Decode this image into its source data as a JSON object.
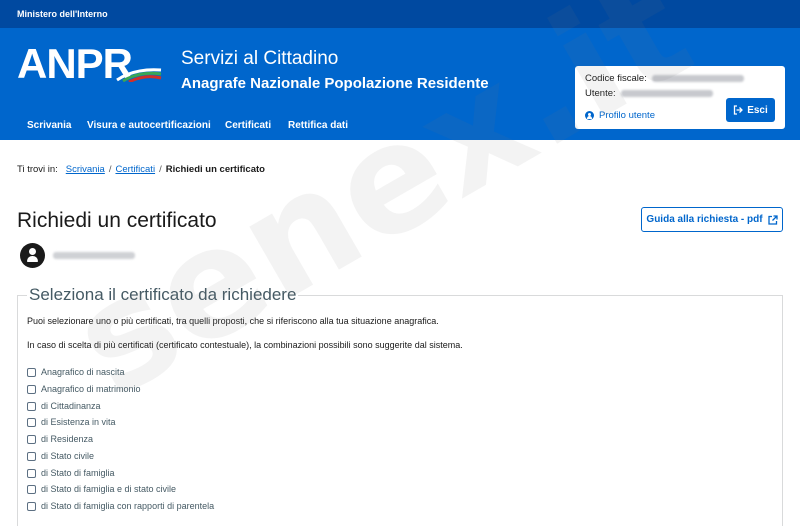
{
  "topbar": {
    "ministry": "Ministero dell'Interno"
  },
  "header": {
    "logo_text": "ANPR",
    "title": "Servizi al Cittadino",
    "subtitle": "Anagrafe Nazionale Popolazione Residente"
  },
  "user": {
    "codice_fiscale_label": "Codice fiscale:",
    "utente_label": "Utente:",
    "profile_link": "Profilo utente",
    "logout_label": "Esci"
  },
  "nav": {
    "items": [
      {
        "label": "Scrivania"
      },
      {
        "label": "Visura e autocertificazioni"
      },
      {
        "label": "Certificati"
      },
      {
        "label": "Rettifica dati"
      }
    ]
  },
  "breadcrumb": {
    "prefix": "Ti trovi in:",
    "items": [
      {
        "label": "Scrivania"
      },
      {
        "label": "Certificati"
      }
    ],
    "separator": "/",
    "current": "Richiedi un certificato"
  },
  "page": {
    "title": "Richiedi un certificato",
    "guide_button": "Guida alla richiesta - pdf"
  },
  "form": {
    "legend": "Seleziona il certificato da richiedere",
    "intro1": "Puoi selezionare uno o più certificati, tra quelli proposti, che si riferiscono alla tua situazione anagrafica.",
    "intro2": "In caso di scelta di più certificati (certificato contestuale), la combinazioni possibili sono suggerite dal sistema.",
    "options": [
      {
        "label": "Anagrafico di nascita",
        "checked": false
      },
      {
        "label": "Anagrafico di matrimonio",
        "checked": false
      },
      {
        "label": "di Cittadinanza",
        "checked": false
      },
      {
        "label": "di Esistenza in vita",
        "checked": false
      },
      {
        "label": "di Residenza",
        "checked": false
      },
      {
        "label": "di Stato civile",
        "checked": false
      },
      {
        "label": "di Stato di famiglia",
        "checked": false
      },
      {
        "label": "di Stato di famiglia e di stato civile",
        "checked": false
      },
      {
        "label": "di Stato di famiglia con rapporti di parentela",
        "checked": false
      }
    ]
  },
  "watermark": "senex.it",
  "colors": {
    "topbar": "#0049a0",
    "header": "#0066cc",
    "accent": "#0066cc",
    "legend": "#455a64"
  }
}
